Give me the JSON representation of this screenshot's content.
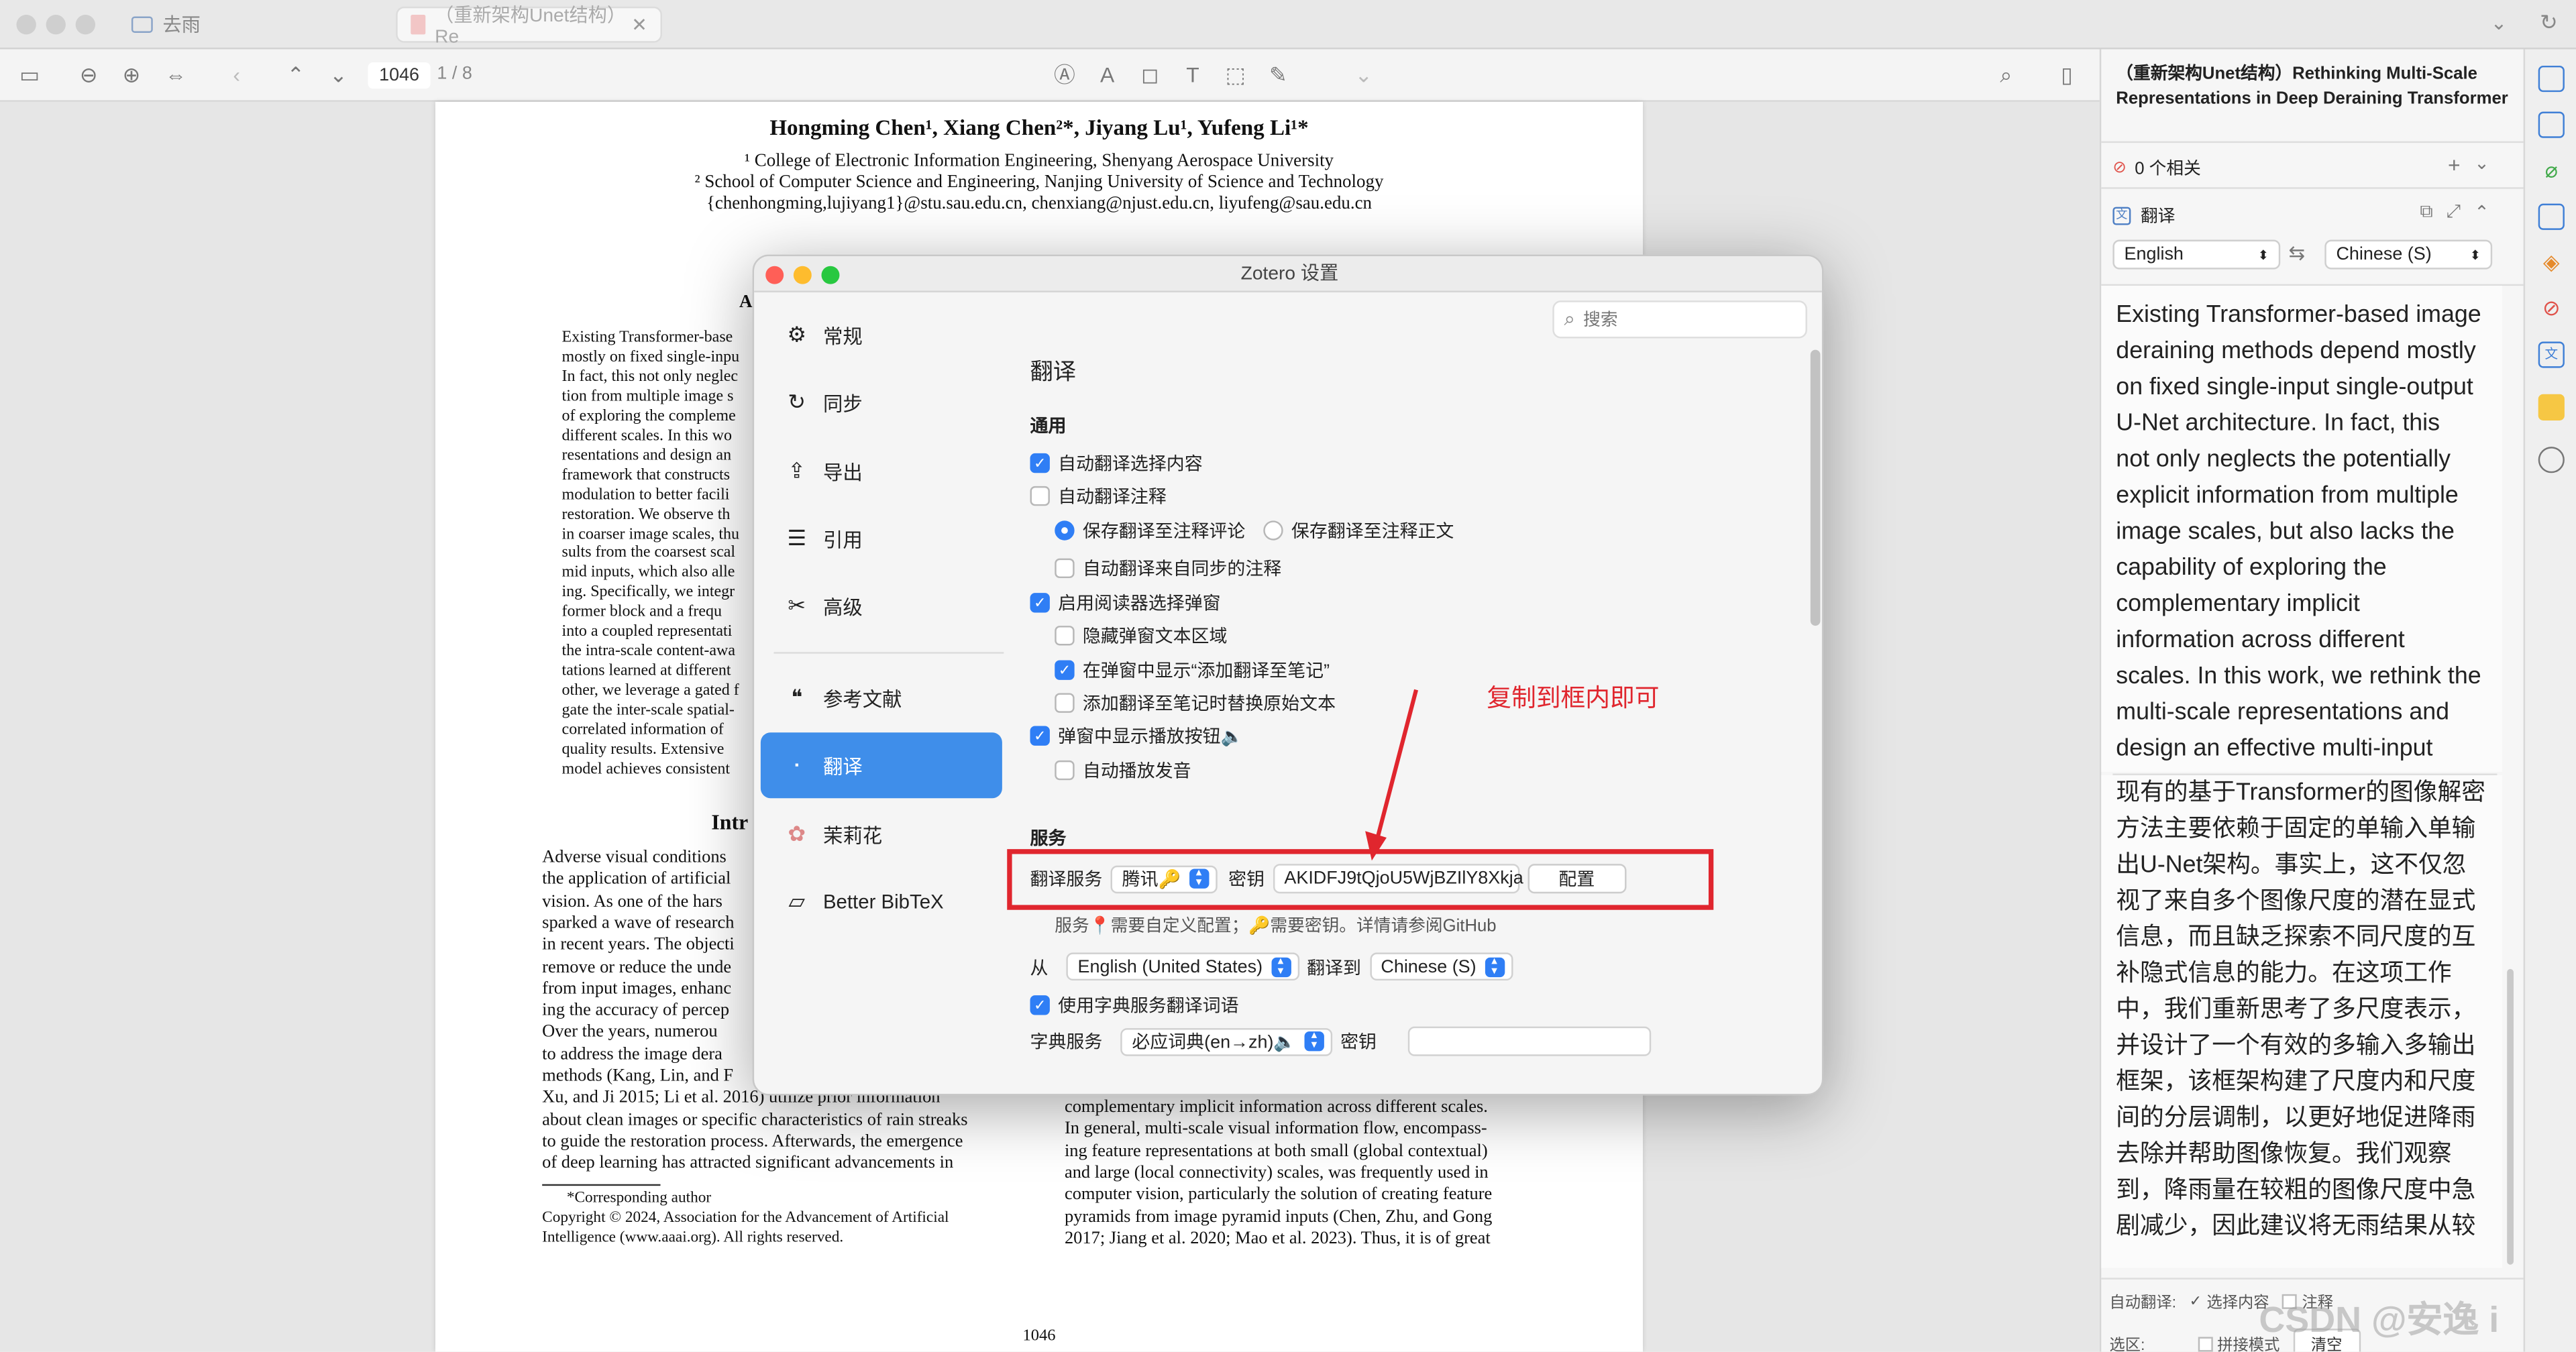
{
  "tabs": [
    {
      "label": "去雨",
      "icon": "folder-icon"
    },
    {
      "label": "（重新架构Unet结构）Re",
      "icon": "pdf-icon"
    }
  ],
  "toolbar": {
    "page_input": "1046",
    "page_total": "1 / 8"
  },
  "pdf": {
    "authors": "Hongming Chen¹, Xiang Chen²*, Jiyang Lu¹, Yufeng Li¹*",
    "affil1": "¹ College of Electronic Information Engineering, Shenyang Aerospace University",
    "affil2": "² School of Computer Science and Engineering, Nanjing University of Science and Technology",
    "emails": "{chenhongming,lujiyang1}@stu.sau.edu.cn, chenxiang@njust.edu.cn, liyufeng@sau.edu.cn",
    "abstract_head": "A",
    "abstract_lines": [
      "Existing Transformer-base",
      "mostly on fixed single-inpu",
      "In fact, this not only neglec",
      "tion from multiple image s",
      "of exploring the compleme",
      "different scales. In this wo",
      "resentations and design an",
      "framework that constructs",
      "modulation to better facili",
      "restoration. We observe th",
      "in coarser image scales, thu",
      "sults from the coarsest scal",
      "mid inputs, which also alle",
      "ing. Specifically, we integr",
      "former block and a frequ",
      "into a coupled representati",
      "the intra-scale content-awa",
      "tations learned at different",
      "other, we leverage a gated f",
      "gate the inter-scale spatial-",
      "correlated information of",
      "quality results. Extensive",
      "model achieves consistent"
    ],
    "intro_head": "Intr",
    "left_lines": [
      "Adverse visual conditions",
      "the application of artificial",
      "vision. As one of the hars",
      "sparked a wave of research",
      "in recent years. The objecti",
      "remove or reduce the unde",
      "from input images, enhanc",
      "ing the accuracy of percep",
      "    Over the years, numerou",
      "to address the image dera",
      "methods (Kang, Lin, and F",
      "Xu, and Ji 2015; Li et al. 2016) utilize prior information",
      "about clean images or specific characteristics of rain streaks",
      "to guide the restoration process. Afterwards, the emergence",
      "of deep learning has attracted significant advancements in"
    ],
    "footnote": "*Corresponding author",
    "copyright1": "Copyright © 2024, Association for the Advancement of Artificial",
    "copyright2": "Intelligence (www.aaai.org). All rights reserved.",
    "right_lines": [
      "complementary implicit information across different scales.",
      "In general, multi-scale visual information flow, encompass-",
      "ing feature representations at both small (global contextual)",
      "and large (local connectivity) scales, was frequently used in",
      "computer vision, particularly the solution of creating feature",
      "pyramids from image pyramid inputs (Chen, Zhu, and Gong",
      "2017; Jiang et al. 2020; Mao et al. 2023). Thus, it is of great"
    ],
    "page_number": "1046"
  },
  "dialog": {
    "title": "Zotero 设置",
    "search_placeholder": "搜索",
    "nav": [
      {
        "label": "常规",
        "icon": "gear-icon"
      },
      {
        "label": "同步",
        "icon": "sync-icon"
      },
      {
        "label": "导出",
        "icon": "export-icon"
      },
      {
        "label": "引用",
        "icon": "cite-icon"
      },
      {
        "label": "高级",
        "icon": "tools-icon"
      },
      {
        "label": "参考文献",
        "icon": "quote-icon"
      },
      {
        "label": "翻译",
        "icon": "translate-icon"
      },
      {
        "label": "茉莉花",
        "icon": "jasmine-icon"
      },
      {
        "label": "Better BibTeX",
        "icon": "bibtex-icon"
      }
    ],
    "section_title": "翻译",
    "general_title": "通用",
    "opts": {
      "auto_translate_sel": "自动翻译选择内容",
      "auto_translate_ann": "自动翻译注释",
      "save_to_comment": "保存翻译至注释评论",
      "save_to_body": "保存翻译至注释正文",
      "auto_translate_sync": "自动翻译来自同步的注释",
      "enable_popup": "启用阅读器选择弹窗",
      "hide_popup_text": "隐藏弹窗文本区域",
      "show_add_to_note": "在弹窗中显示“添加翻译至笔记”",
      "replace_original": "添加翻译至笔记时替换原始文本",
      "show_play_btn": "弹窗中显示播放按钮🔈",
      "auto_play": "自动播放发音"
    },
    "service_title": "服务",
    "service_label": "翻译服务",
    "service_value": "腾讯🔑",
    "key_label": "密钥",
    "key_value": "AKIDFJ9tQjoU5WjBZIlY8Xkja",
    "config_btn": "配置",
    "service_hint": "服务📍需要自定义配置；🔑需要密钥。详情请参阅GitHub",
    "from_label": "从",
    "from_value": "English (United States)",
    "to_label": "翻译到",
    "to_value": "Chinese (S)",
    "use_dict": "使用字典服务翻译词语",
    "dict_label": "字典服务",
    "dict_value": "必应词典(en→zh)🔈",
    "dict_key_label": "密钥",
    "annotation": "复制到框内即可",
    "colors": {
      "accent": "#2f7ef5",
      "highlight": "#e0262e"
    }
  },
  "rpane": {
    "doc_title": "（重新架构Unet结构）Rethinking Multi-Scale Representations in Deep Deraining Transformer",
    "related": "0 个相关",
    "translate_label": "翻译",
    "src_lang": "English",
    "tgt_lang": "Chinese (S)",
    "source_lines": [
      "Existing Transformer-based image",
      "deraining methods depend mostly",
      "on fixed single-input single-output",
      "U-Net architecture. In fact, this",
      "not only neglects the potentially",
      "explicit information from multiple",
      "image scales, but also lacks the",
      "capability of exploring the",
      "complementary implicit",
      "information across different",
      "scales. In this work, we rethink the",
      "multi-scale representations and",
      "design an effective multi-input"
    ],
    "target_lines": [
      "现有的基于Transformer的图像解密",
      "方法主要依赖于固定的单输入单输",
      "出U-Net架构。事实上，这不仅忽",
      "视了来自多个图像尺度的潜在显式",
      "信息，而且缺乏探索不同尺度的互",
      "补隐式信息的能力。在这项工作",
      "中，我们重新思考了多尺度表示，",
      "并设计了一个有效的多输入多输出",
      "框架，该框架构建了尺度内和尺度",
      "间的分层调制，以更好地促进降雨",
      "去除并帮助图像恢复。我们观察",
      "到，降雨量在较粗的图像尺度中急",
      "剧减少，因此建议将无雨结果从较"
    ],
    "auto_translate": "自动翻译:",
    "sel_content": "选择内容",
    "annot": "注释",
    "select_area": "选区:",
    "concat_mode": "拼接模式",
    "clear_btn": "清空"
  },
  "watermark": "CSDN @安逸 i"
}
